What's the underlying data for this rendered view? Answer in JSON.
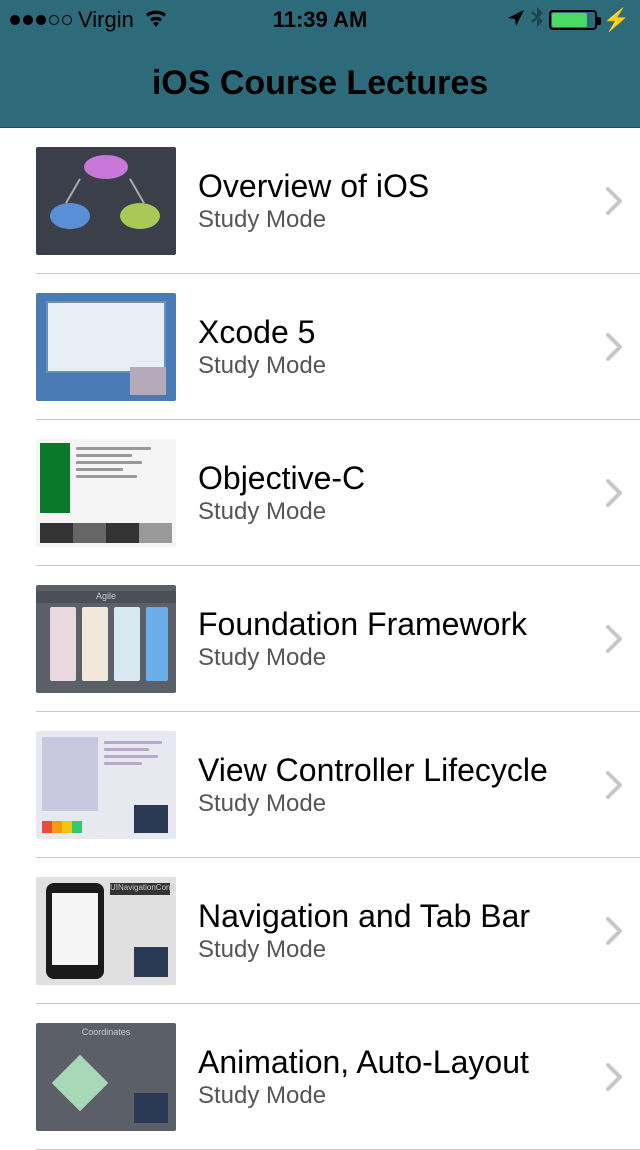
{
  "statusbar": {
    "carrier": "Virgin",
    "time": "11:39 AM",
    "battery_pct": 80
  },
  "nav": {
    "title": "iOS Course Lectures"
  },
  "lectures": [
    {
      "title": "Overview of iOS",
      "subtitle": "Study Mode",
      "thumb": "t1"
    },
    {
      "title": "Xcode 5",
      "subtitle": "Study Mode",
      "thumb": "t2"
    },
    {
      "title": "Objective-C",
      "subtitle": "Study Mode",
      "thumb": "t3"
    },
    {
      "title": "Foundation Framework",
      "subtitle": "Study Mode",
      "thumb": "t4"
    },
    {
      "title": "View Controller Lifecycle",
      "subtitle": "Study Mode",
      "thumb": "t5"
    },
    {
      "title": "Navigation and Tab Bar",
      "subtitle": "Study Mode",
      "thumb": "t6"
    },
    {
      "title": "Animation, Auto-Layout",
      "subtitle": "Study Mode",
      "thumb": "t7"
    }
  ]
}
